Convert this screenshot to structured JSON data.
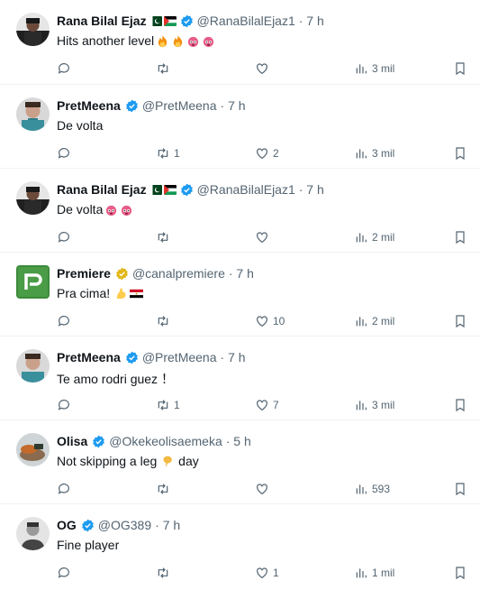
{
  "colors": {
    "verified": "#1d9bf0",
    "gold": "#e2b719",
    "text": "#0f1419",
    "muted": "#536471"
  },
  "tweets": [
    {
      "name": "Rana Bilal Ejaz",
      "flags": [
        "pakistan-flag",
        "palestine-flag"
      ],
      "verified": "blue",
      "handle": "@RanaBilalEjaz1",
      "time": "· 7 h",
      "text": "Hits another level",
      "emojis": [
        "fire-emoji",
        "fire-emoji",
        "exploding-head-emoji",
        "exploding-head-emoji"
      ],
      "replies": "",
      "retweets": "",
      "likes": "",
      "views": "3 mil"
    },
    {
      "name": "PretMeena",
      "flags": [],
      "verified": "blue",
      "handle": "@PretMeena",
      "time": "· 7 h",
      "text": "De volta",
      "emojis": [],
      "replies": "",
      "retweets": "1",
      "likes": "2",
      "views": "3 mil"
    },
    {
      "name": "Rana Bilal Ejaz",
      "flags": [
        "pakistan-flag",
        "palestine-flag"
      ],
      "verified": "blue",
      "handle": "@RanaBilalEjaz1",
      "time": "· 7 h",
      "text": "De volta",
      "emojis": [
        "exploding-head-emoji",
        "exploding-head-emoji"
      ],
      "replies": "",
      "retweets": "",
      "likes": "",
      "views": "2 mil"
    },
    {
      "name": "Premiere",
      "flags": [],
      "verified": "gold",
      "handle": "@canalpremiere",
      "time": "· 7 h",
      "text": "Pra cima!",
      "emojis": [
        "flexed-biceps-emoji",
        "egypt-flag-emoji"
      ],
      "replies": "",
      "retweets": "",
      "likes": "10",
      "views": "2 mil"
    },
    {
      "name": "PretMeena",
      "flags": [],
      "verified": "blue",
      "handle": "@PretMeena",
      "time": "· 7 h",
      "text": "Te amo rodri guez ！",
      "emojis": [],
      "replies": "",
      "retweets": "1",
      "likes": "7",
      "views": "3 mil"
    },
    {
      "name": "Olisa",
      "flags": [],
      "verified": "blue",
      "handle": "@Okekeolisaemeka",
      "time": "· 5 h",
      "text": "Not skipping a leg",
      "emojis": [
        "drumstick-emoji"
      ],
      "text_after": " day",
      "replies": "",
      "retweets": "",
      "likes": "",
      "views": "593"
    },
    {
      "name": "OG",
      "flags": [],
      "verified": "blue",
      "handle": "@OG389",
      "time": "· 7 h",
      "text": "Fine player",
      "emojis": [],
      "replies": "",
      "retweets": "",
      "likes": "1",
      "views": "1 mil"
    }
  ]
}
